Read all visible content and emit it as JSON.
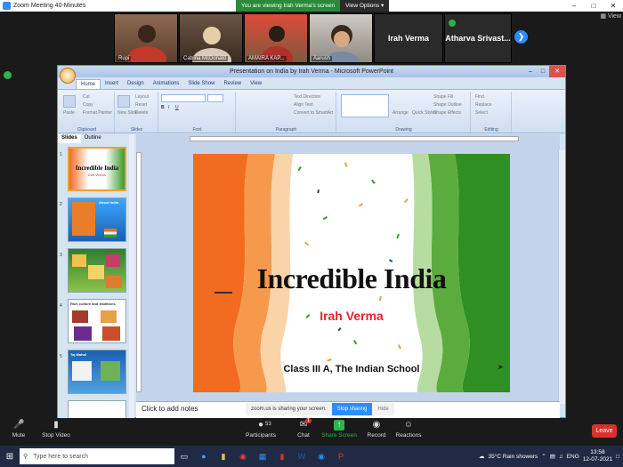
{
  "zoom": {
    "window_title": "Zoom Meeting 40-Minutes",
    "viewing_banner": "You are viewing Irah Verma's screen",
    "view_options": "View Options",
    "view_label": "View",
    "participants": [
      {
        "name": "Rupi"
      },
      {
        "name": "Catrina McDonald"
      },
      {
        "name": "AMAIRA KAP..."
      },
      {
        "name": "Aarush"
      },
      {
        "name": "Irah Verma"
      },
      {
        "name": "Atharva Srivast..."
      }
    ],
    "share_bar": {
      "status": "zoom.us is sharing your screen.",
      "stop": "Stop sharing",
      "hide": "Hide"
    },
    "controls": {
      "mute": "Mute",
      "video": "Stop Video",
      "participants": "Participants",
      "participants_count": "53",
      "chat": "Chat",
      "chat_badge": "1",
      "share": "Share Screen",
      "record": "Record",
      "reactions": "Reactions",
      "leave": "Leave"
    }
  },
  "ppt": {
    "window_title": "Presentation on India by Irah Verma - Microsoft PowerPoint",
    "tabs": [
      "Home",
      "Insert",
      "Design",
      "Animations",
      "Slide Show",
      "Review",
      "View"
    ],
    "groups": [
      "Clipboard",
      "Slides",
      "Font",
      "Paragraph",
      "Drawing",
      "Editing"
    ],
    "ribbon_items": {
      "paste": "Paste",
      "cut": "Cut",
      "copy": "Copy",
      "format_painter": "Format Painter",
      "new_slide": "New Slide",
      "layout": "Layout",
      "reset": "Reset",
      "delete": "Delete",
      "text_direction": "Text Direction",
      "align_text": "Align Text",
      "convert_smartart": "Convert to SmartArt",
      "arrange": "Arrange",
      "quick_styles": "Quick Styles",
      "shape_fill": "Shape Fill",
      "shape_outline": "Shape Outline",
      "shape_effects": "Shape Effects",
      "find": "Find",
      "replace": "Replace",
      "select": "Select"
    },
    "pane_tabs": [
      "Slides",
      "Outline"
    ],
    "thumbnails": [
      {
        "num": "1",
        "title": "Incredible India",
        "sub": "Irah Verma"
      },
      {
        "num": "2",
        "title": "About India"
      },
      {
        "num": "3",
        "title": ""
      },
      {
        "num": "4",
        "title": "Rich culture and traditions"
      },
      {
        "num": "5",
        "title": "Taj Mahal"
      }
    ],
    "slide": {
      "title": "Incredible India",
      "subtitle": "Irah Verma",
      "school": "Class III A, The Indian School"
    },
    "notes_placeholder": "Click to add notes"
  },
  "taskbar": {
    "search_placeholder": "Type here to search",
    "weather": "35°C Rain showers",
    "lang": "ENG",
    "time": "13:58",
    "date": "12-07-2021"
  },
  "colors": {
    "saffron": "#f26b21",
    "green": "#3a9a2a",
    "zoom_blue": "#2d8cff",
    "leave_red": "#d9312c",
    "subtitle_red": "#e2262a"
  }
}
